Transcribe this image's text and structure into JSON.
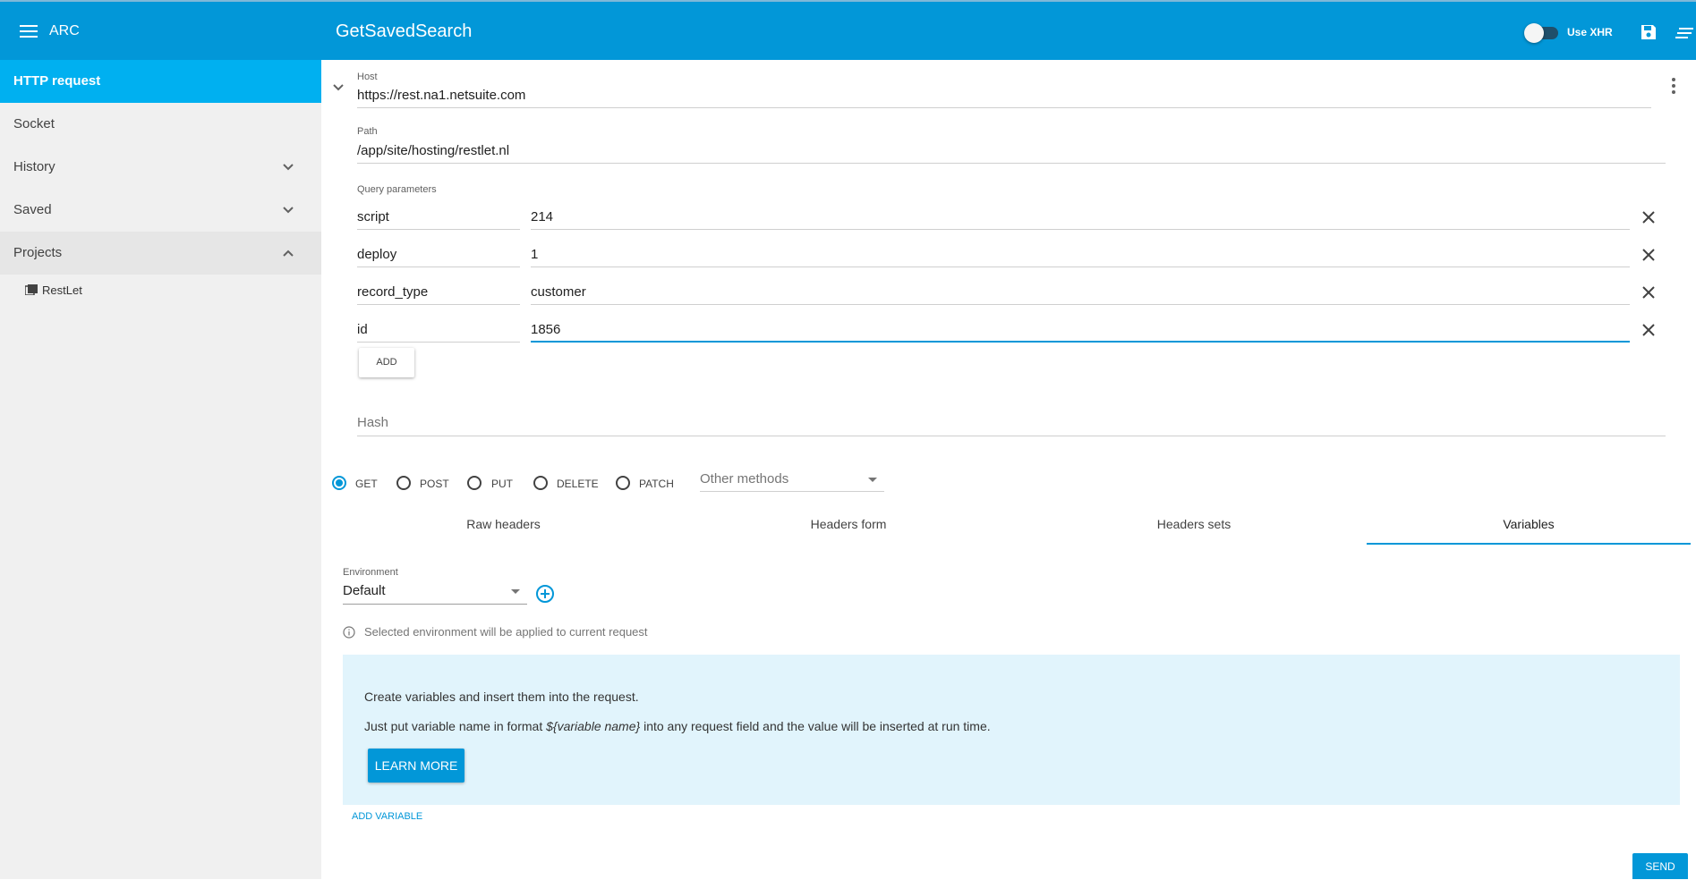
{
  "app": {
    "name": "ARC"
  },
  "header": {
    "title": "GetSavedSearch",
    "xhr_label": "Use XHR",
    "xhr_enabled": false,
    "save_icon": "save-icon",
    "menu_icon": "hamburger-icon"
  },
  "sidebar": {
    "items": [
      {
        "label": "HTTP request",
        "selected": true
      },
      {
        "label": "Socket"
      },
      {
        "label": "History",
        "icon": "chevron-down-icon"
      },
      {
        "label": "Saved",
        "icon": "chevron-down-icon"
      },
      {
        "label": "Projects",
        "icon": "chevron-up-icon"
      }
    ],
    "projects": [
      {
        "label": "RestLet",
        "icon": "project-icon"
      }
    ]
  },
  "request": {
    "host_label": "Host",
    "host": "https://rest.na1.netsuite.com",
    "path_label": "Path",
    "path": "/app/site/hosting/restlet.nl",
    "query_label": "Query parameters",
    "params": [
      {
        "name": "script",
        "value": "214"
      },
      {
        "name": "deploy",
        "value": "1"
      },
      {
        "name": "record_type",
        "value": "customer"
      },
      {
        "name": "id",
        "value": "1856"
      }
    ],
    "add_label": "ADD",
    "hash_placeholder": "Hash",
    "methods": [
      "GET",
      "POST",
      "PUT",
      "DELETE",
      "PATCH"
    ],
    "selected_method": "GET",
    "other_methods_label": "Other methods"
  },
  "tabs": {
    "items": [
      "Raw headers",
      "Headers form",
      "Headers sets",
      "Variables"
    ],
    "selected": "Variables"
  },
  "variables": {
    "env_label": "Environment",
    "env_value": "Default",
    "info_text": "Selected environment will be applied to current request",
    "banner_line1": "Create variables and insert them into the request.",
    "banner_line2_pre": "Just put variable name in format ",
    "banner_line2_code": "${variable name}",
    "banner_line2_post": " into any request field and the value will be inserted at run time.",
    "learn_more": "LEARN MORE",
    "add_variable": "ADD VARIABLE"
  },
  "send_label": "SEND",
  "colors": {
    "primary": "#0297d8",
    "sidebar_selected": "#00b0f0",
    "banner": "#e1f4fc"
  }
}
